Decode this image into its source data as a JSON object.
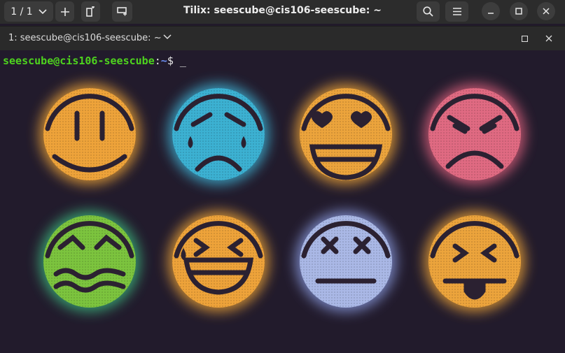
{
  "window": {
    "title": "Tilix: seescube@cis106-seescube: ~",
    "session_label": "1 / 1"
  },
  "tab": {
    "title": "1: seescube@cis106-seescube: ~"
  },
  "terminal": {
    "prompt_user": "seescube@cis106-seescube",
    "prompt_sep": ":",
    "prompt_path": "~",
    "prompt_symbol": "$",
    "cursor": "_"
  },
  "icons": [
    "chevron-down-icon",
    "plus-icon",
    "split-pane-icon",
    "add-terminal-icon",
    "search-icon",
    "hamburger-menu-icon",
    "minimize-icon",
    "maximize-icon",
    "close-icon"
  ],
  "colors": {
    "prompt_user": "#4ed31e",
    "prompt_path": "#6b8df0",
    "terminal_bg": "#221b2c",
    "emoji_orange": "#f0a638",
    "emoji_cyan": "#3fb6d8",
    "emoji_pink": "#e0627e",
    "emoji_green": "#6cc64a",
    "emoji_lavender": "#aab8e6"
  },
  "wallpaper_faces": [
    "neutral",
    "crying",
    "heart-eyes",
    "angry",
    "nauseated",
    "laughing",
    "dead",
    "tongue-out"
  ]
}
